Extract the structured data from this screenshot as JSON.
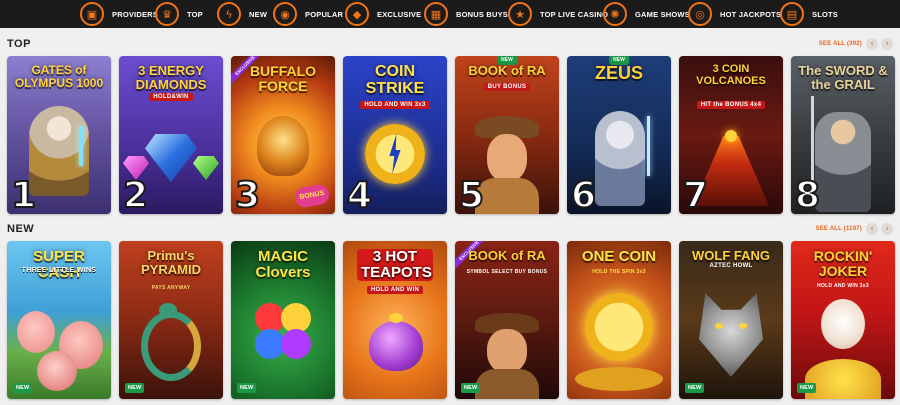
{
  "categories": [
    {
      "label": "PROVIDERS",
      "icon": "providers-icon",
      "glyph": "▣"
    },
    {
      "label": "TOP",
      "icon": "crown-icon",
      "glyph": "♛"
    },
    {
      "label": "NEW",
      "icon": "bolt-icon",
      "glyph": "ϟ"
    },
    {
      "label": "POPULAR",
      "icon": "flame-icon",
      "glyph": "◉"
    },
    {
      "label": "EXCLUSIVE",
      "icon": "diamond-icon",
      "glyph": "◆"
    },
    {
      "label": "BONUS BUYS",
      "icon": "gift-icon",
      "glyph": "▦"
    },
    {
      "label": "TOP LIVE CASINO",
      "icon": "star-icon",
      "glyph": "★"
    },
    {
      "label": "GAME SHOWS",
      "icon": "wheel-icon",
      "glyph": "✺"
    },
    {
      "label": "HOT JACKPOTS",
      "icon": "coins-icon",
      "glyph": "◎"
    },
    {
      "label": "SLOTS",
      "icon": "slot-machine-icon",
      "glyph": "▤"
    }
  ],
  "top": {
    "title": "TOP",
    "see_all": "SEE ALL (392)",
    "prev": "‹",
    "next": "›",
    "games": [
      {
        "name": "GATES of OLYMPUS 1000",
        "rank": "1",
        "bg": "#6a5aa8",
        "color": "#ffd23c"
      },
      {
        "name": "3 ENERGY DIAMONDS",
        "sub": "HOLD&WIN",
        "rank": "2",
        "bg": "#5a3cae",
        "color": "#ffd23c"
      },
      {
        "name": "BUFFALO FORCE",
        "rank": "3",
        "bg": "#c9501a",
        "color": "#ffd23c",
        "exclusive": "EXCLUSIVE",
        "bonus": "BONUS"
      },
      {
        "name": "COIN STRIKE",
        "sub": "HOLD AND WIN 3x3",
        "rank": "4",
        "bg": "#2a3aa8",
        "color": "#ffe24a"
      },
      {
        "name": "BOOK of RA",
        "sub": "BUY BONUS",
        "rank": "5",
        "bg": "#8a3412",
        "color": "#ffcf3a",
        "top_badge": "NEW"
      },
      {
        "name": "ZEUS",
        "rank": "6",
        "bg": "#17305a",
        "color": "#ffcf3a",
        "top_badge": "NEW"
      },
      {
        "name": "3 COIN VOLCANOES",
        "sub": "HIT the BONUS 4x4",
        "rank": "7",
        "bg": "#4a1414",
        "color": "#ffd23c"
      },
      {
        "name": "The SWORD & the GRAIL",
        "rank": "8",
        "bg": "#3a3e40",
        "color": "#e8d39a"
      }
    ]
  },
  "new": {
    "title": "NEW",
    "see_all": "SEE ALL (1197)",
    "prev": "‹",
    "next": "›",
    "games": [
      {
        "name": "SUPER CASH",
        "sub": "THREE LITTLE WINS",
        "bg": "#3f9fd6",
        "color": "#ffe24a",
        "badge": "NEW"
      },
      {
        "name": "Primu's PYRAMID",
        "sub": "PAYS ANYWAY",
        "bg": "#a8321c",
        "color": "#f7d36a",
        "badge": "NEW"
      },
      {
        "name": "MAGIC Clovers",
        "bg": "#1c7a2e",
        "color": "#ffe24a",
        "badge": "NEW"
      },
      {
        "name": "3 HOT TEAPOTS",
        "sub": "HOLD AND WIN",
        "bg": "#e8751a",
        "color": "#ffffff",
        "badge": ""
      },
      {
        "name": "BOOK of RA",
        "sub": "SYMBOL SELECT BUY BONUS",
        "bg": "#6a1a14",
        "color": "#ffcf3a",
        "badge": "NEW",
        "exclusive": "EXCLUSIVE"
      },
      {
        "name": "ONE COIN",
        "sub": "HOLD THE SPIN 3x3",
        "bg": "#c7541a",
        "color": "#ffe24a",
        "badge": ""
      },
      {
        "name": "WOLF FANG",
        "sub": "AZTEC HOWL",
        "bg": "#5a3a1a",
        "color": "#ffd23c",
        "badge": "NEW"
      },
      {
        "name": "ROCKIN' JOKER",
        "sub": "HOLD AND WIN 3x3",
        "bg": "#c21616",
        "color": "#ffd23c",
        "badge": "NEW"
      }
    ]
  }
}
